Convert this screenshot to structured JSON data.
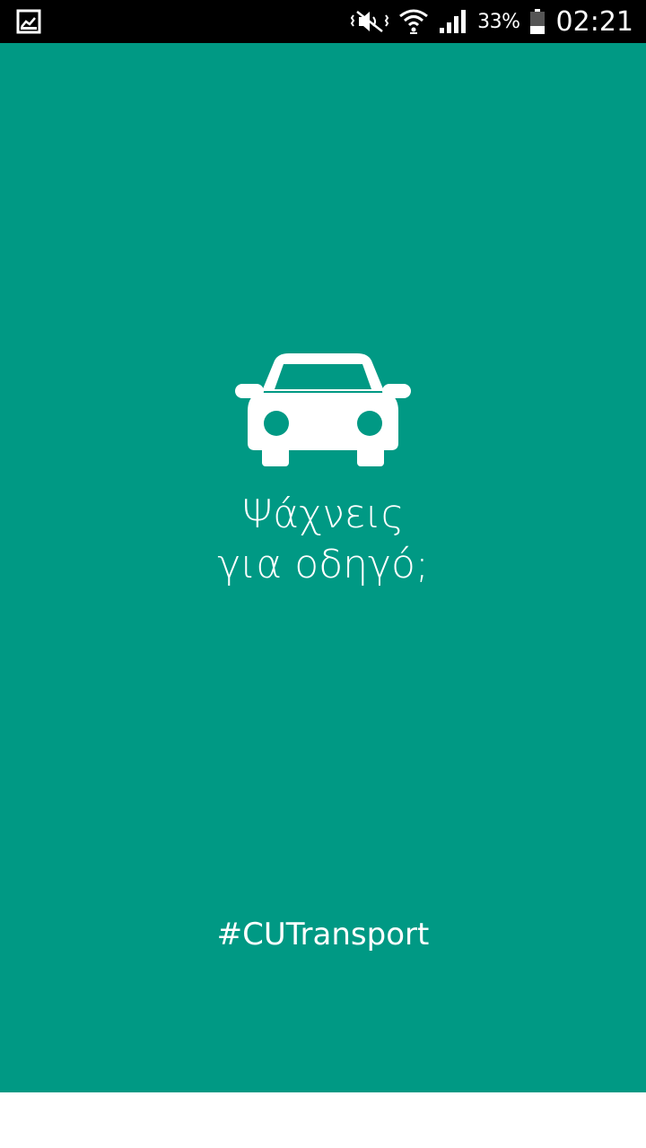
{
  "status_bar": {
    "battery_percent": "33%",
    "time": "02:21",
    "icons": [
      "gallery-notification-icon",
      "mute-vibrate-icon",
      "wifi-icon",
      "signal-icon",
      "battery-icon"
    ]
  },
  "splash": {
    "background_color": "#009984",
    "icon": "car-icon",
    "headline_line1": "Ψάχνεις",
    "headline_line2": "για οδηγό;",
    "hashtag": "#CUTransport"
  }
}
